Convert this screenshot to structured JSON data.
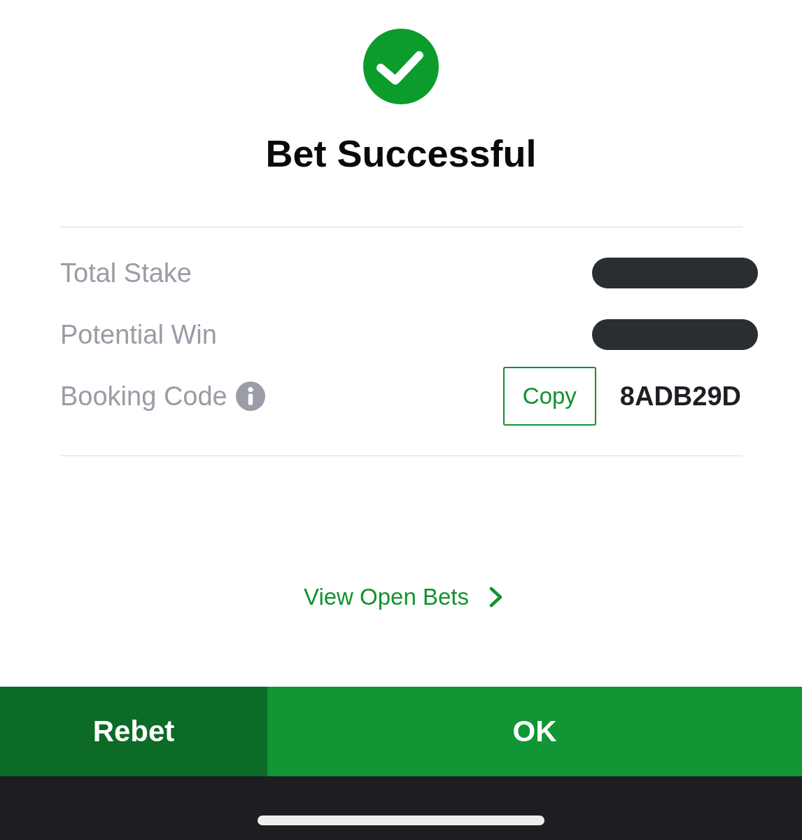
{
  "status": {
    "kind": "success",
    "title": "Bet Successful"
  },
  "summary": {
    "rows": [
      {
        "kind": "hidden",
        "label": "Total Stake",
        "info": false
      },
      {
        "kind": "hidden",
        "label": "Potential Win",
        "info": false
      },
      {
        "kind": "code",
        "label": "Booking Code",
        "info": true,
        "copy_label": "Copy",
        "value": "8ADB29D"
      }
    ]
  },
  "link": {
    "label": "View Open Bets"
  },
  "actions": [
    {
      "kind": "secondary",
      "label": "Rebet"
    },
    {
      "kind": "primary",
      "label": "OK"
    }
  ]
}
